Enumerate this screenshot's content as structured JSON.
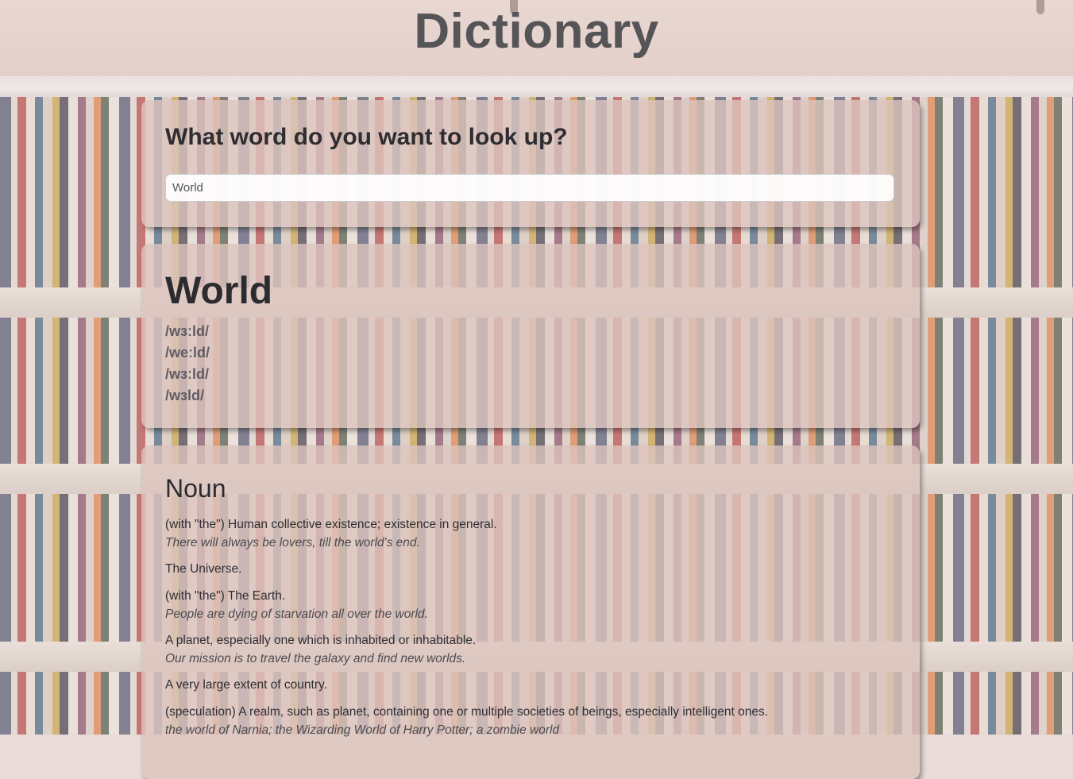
{
  "app": {
    "title": "Dictionary"
  },
  "search": {
    "prompt": "What word do you want to look up?",
    "value": "World"
  },
  "entry": {
    "word": "World",
    "phonetics": [
      "/wɜːld/",
      "/weːld/",
      "/wɜːld/",
      "/wɜld/"
    ]
  },
  "meaning": {
    "part_of_speech": "Noun",
    "definitions": [
      {
        "text": "(with \"the\") Human collective existence; existence in general.",
        "example": "There will always be lovers, till the world's end."
      },
      {
        "text": "The Universe.",
        "example": ""
      },
      {
        "text": "(with \"the\") The Earth.",
        "example": "People are dying of starvation all over the world."
      },
      {
        "text": "A planet, especially one which is inhabited or inhabitable.",
        "example": "Our mission is to travel the galaxy and find new worlds."
      },
      {
        "text": "A very large extent of country.",
        "example": ""
      },
      {
        "text": "(speculation) A realm, such as planet, containing one or multiple societies of beings, especially intelligent ones.",
        "example": "the world of Narnia; the Wizarding World of Harry Potter; a zombie world"
      }
    ]
  },
  "colors": {
    "card_background": "#dcc4be",
    "title_text": "#555457",
    "heading_text": "#2c2b2f"
  }
}
